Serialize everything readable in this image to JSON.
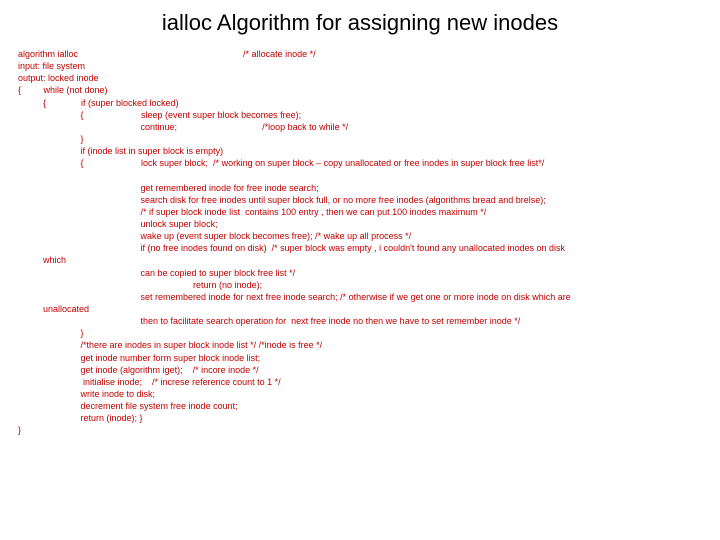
{
  "title": "ialloc Algorithm for assigning new inodes",
  "code": "algorithm ialloc                                                                  /* allocate inode */\ninput: file system\noutput: locked inode\n{         while (not done)\n          {              if (super blocked locked)\n                         {                       sleep (event super block becomes free);\n                                                 continue;                                  /*loop back to while */\n                         }\n                         if (inode list in super block is empty)\n                         {                       lock super block;  /* working on super block – copy unallocated or free inodes in super block free list*/\n\n                                                 get remembered inode for free inode search;\n                                                 search disk for free inodes until super block full, or no more free inodes (algorithms bread and brelse);\n                                                 /* if super block inode list  contains 100 entry , then we can put 100 inodes maximum */\n                                                 unlock super block;\n                                                 wake up (event super block becomes free); /* wake up all process */\n                                                 if (no free inodes found on disk)  /* super block was empty , i couldn't found any unallocated inodes on disk\n          which\n                                                 can be copied to super block free list */\n                                                                      return (no inode);\n                                                 set remembered inode for next free inode search; /* otherwise if we get one or more inode on disk which are\n          unallocated\n                                                 then to facilitate search operation for  next free inode no then we have to set remember inode */\n                         }\n                         /*there are inodes in super block inode list */ /*inode is free */\n                         get inode number form super block inode list;\n                         get inode (algorithm iget);    /* incore inode */\n                          initialise inode;    /* increse reference count to 1 */\n                         write inode to disk;\n                         decrement file system free inode count;\n                         return (inode); }\n}",
  "chart_data": {
    "type": "table",
    "title": "ialloc Algorithm pseudocode",
    "algorithm_name": "ialloc",
    "purpose": "allocate inode",
    "input": "file system",
    "output": "locked inode",
    "pseudocode_lines": [
      "while (not done)",
      "  if (super blocked locked)",
      "    sleep (event super block becomes free);",
      "    continue; /*loop back to while */",
      "  if (inode list in super block is empty)",
      "    lock super block; /* working on super block – copy unallocated or free inodes in super block free list*/",
      "    get remembered inode for free inode search;",
      "    search disk for free inodes until super block full, or no more free inodes (algorithms bread and brelse);",
      "    /* if super block inode list contains 100 entry , then we can put 100 inodes maximum */",
      "    unlock super block;",
      "    wake up (event super block becomes free); /* wake up all process */",
      "    if (no free inodes found on disk) /* super block was empty , i couldn't found any unallocated inodes on disk which can be copied to super block free list */",
      "      return (no inode);",
      "    set remembered inode for next free inode search; /* otherwise if we get one or more inode on disk which are unallocated then to facilitate search operation for next free inode no then we have to set remember inode */",
      "  /*there are inodes in super block inode list */ /*inode is free */",
      "  get inode number form super block inode list;",
      "  get inode (algorithm iget); /* incore inode */",
      "  initialise inode; /* increse reference count to 1 */",
      "  write inode to disk;",
      "  decrement file system free inode count;",
      "  return (inode);"
    ]
  }
}
